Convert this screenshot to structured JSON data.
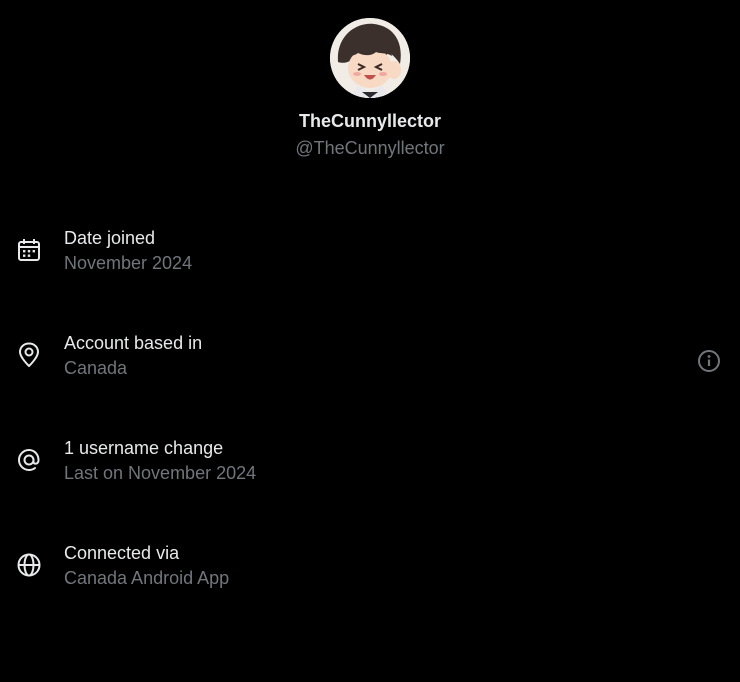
{
  "profile": {
    "display_name": "TheCunnyllector",
    "handle": "@TheCunnyllector"
  },
  "rows": [
    {
      "icon": "calendar-icon",
      "title": "Date joined",
      "subtitle": "November 2024"
    },
    {
      "icon": "location-pin-icon",
      "title": "Account based in",
      "subtitle": "Canada",
      "action_icon": "info-icon"
    },
    {
      "icon": "at-sign-icon",
      "title": "1 username change",
      "subtitle": "Last on November 2024"
    },
    {
      "icon": "globe-icon",
      "title": "Connected via",
      "subtitle": "Canada Android App"
    }
  ],
  "colors": {
    "background": "#000000",
    "primary_text": "#e7e9ea",
    "secondary_text": "#71767b"
  }
}
